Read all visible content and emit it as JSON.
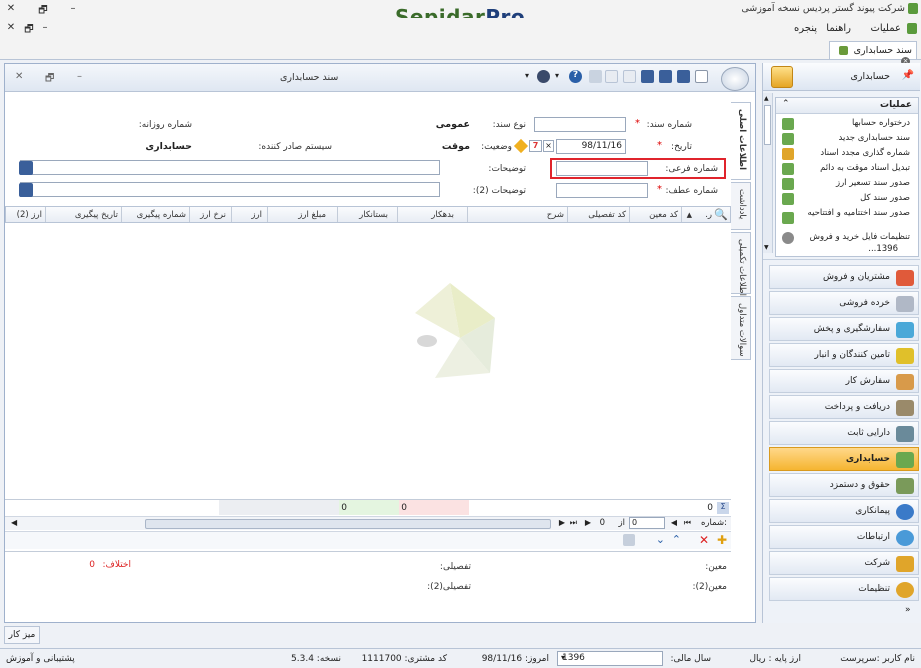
{
  "app": {
    "title": "شرکت پیوند گستر پردیس نسخه آموزشی",
    "logo_a": "Sepidar",
    "logo_b": "Pro"
  },
  "window_controls": {
    "close": "✕",
    "restore": "🗗",
    "minimize": "–"
  },
  "menu": {
    "operations": "عملیات",
    "help": "راهنما",
    "window": "پنجره"
  },
  "tab": {
    "label": "سند حسابداری"
  },
  "inner_window": {
    "title": "سند حسابداری"
  },
  "form": {
    "doc_number_label": "شماره سند:",
    "doc_type_label": "نوع سند:",
    "doc_type_value": "عمومی",
    "daily_number_label": "شماره روزانه:",
    "date_label": "تاریخ:",
    "date_value": "98/11/16",
    "status_label": "وضعیت:",
    "status_value": "موقت",
    "issuer_label": "سیستم صادر کننده:",
    "issuer_value": "حسابداری",
    "sub_number_label": "شماره فرعی:",
    "description_label": "توضیحات:",
    "ref_number_label": "شماره عطف:",
    "description2_label": "توضیحات (2):"
  },
  "grid": {
    "columns": [
      "ر.",
      "کد معین",
      "کد تفصیلی",
      "شرح",
      "بدهکار",
      "بستانکار",
      "مبلغ ارز",
      "ارز",
      "نرخ ارز",
      "شماره پیگیری",
      "تاریخ پیگیری",
      "ارز (2)"
    ],
    "totals": {
      "row_count": "0",
      "debit": "0",
      "credit": "0"
    }
  },
  "navigation": {
    "row_label": ":شماره",
    "of_label": "از",
    "current": "0",
    "total": "0"
  },
  "bottom": {
    "moein_label": "معین:",
    "tafsili_label": "تفصیلی:",
    "moein2_label": "معین(2):",
    "tafsili2_label": "تفصیلی(2):",
    "diff_label": "اختلاف:",
    "diff_value": "0"
  },
  "side_tabs": [
    "اطلاعات اصلی",
    "یادداشت",
    "اطلاعات تکمیلی",
    "سوالات متداول"
  ],
  "sidebar": {
    "header": "حسابداری",
    "ops_title": "عملیات",
    "ops": [
      "درختواره حسابها",
      "سند حسابداری جدید",
      "شماره گذاری مجدد اسناد",
      "تبدیل اسناد موقت به دائم",
      "صدور سند تسعیر ارز",
      "صدور سند کل",
      "صدور سند اختتامیه و افتتاحیه",
      "تنظیمات فایل خرید و فروش"
    ],
    "ops_overflow": "1396...",
    "modules": [
      "مشتریان و فروش",
      "خرده فروشی",
      "سفارشگیری و پخش",
      "تامین کنندگان و انبار",
      "سفارش کار",
      "دریافت و پرداخت",
      "دارایی ثابت",
      "حسابداری",
      "حقوق و دستمزد",
      "پیمانکاری",
      "ارتباطات",
      "شرکت",
      "تنظیمات"
    ],
    "active_module": "حسابداری"
  },
  "desk_button": "میز کار",
  "status": {
    "user": "نام کاربر :سرپرست",
    "base_currency": "ارز پایه : ریال",
    "fiscal_year_label": "سال مالی:",
    "fiscal_year": "1396",
    "today": "امروز: 98/11/16",
    "customer_code": "کد مشتری: 1111700",
    "version": "نسخه: 5.3.4",
    "support": "پشتیبانی و آموزش"
  },
  "colors": {
    "accent_orange": "#f5b531",
    "highlight_red": "#e0242c",
    "logo_green": "#3a6b2a",
    "logo_blue": "#1f3f7a"
  }
}
